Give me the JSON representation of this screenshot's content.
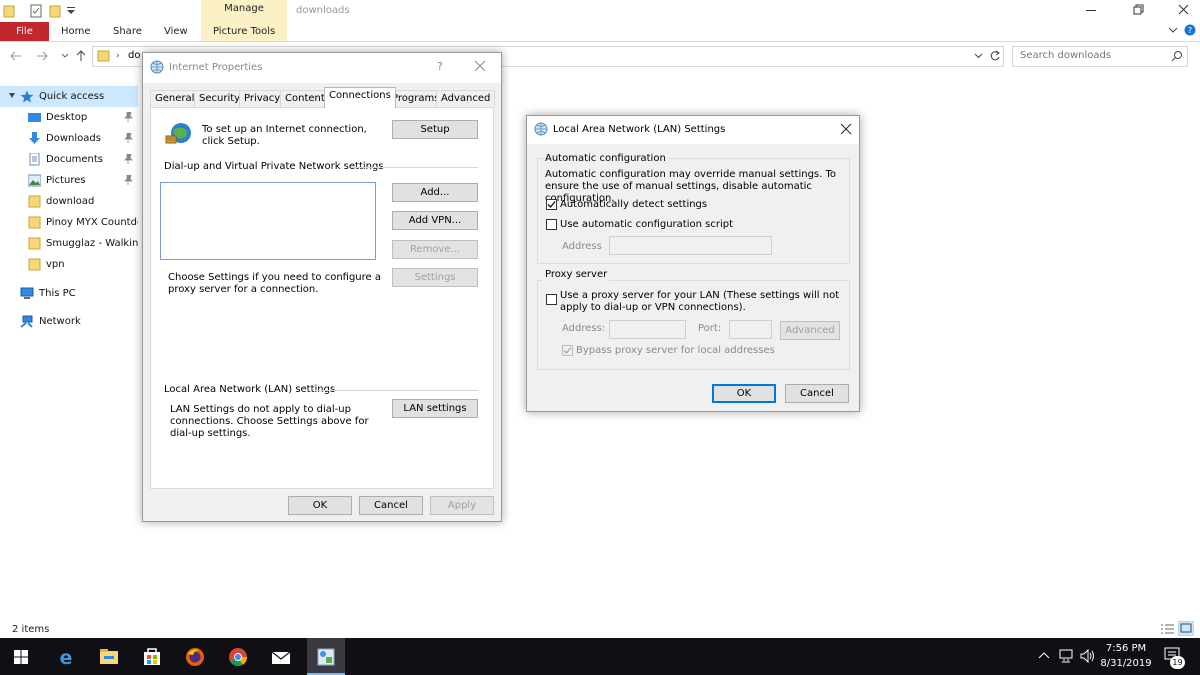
{
  "explorer": {
    "window_title": "downloads",
    "contextual_tab": "Manage",
    "tabs": [
      "File",
      "Home",
      "Share",
      "View",
      "Picture Tools"
    ],
    "address_path": "do",
    "search_placeholder": "Search downloads",
    "nav": {
      "quick_access": "Quick access",
      "items": [
        {
          "label": "Desktop",
          "icon": "desktop-icon",
          "pinned": true
        },
        {
          "label": "Downloads",
          "icon": "download-arrow-icon",
          "pinned": true
        },
        {
          "label": "Documents",
          "icon": "documents-icon",
          "pinned": true
        },
        {
          "label": "Pictures",
          "icon": "pictures-icon",
          "pinned": true
        },
        {
          "label": "download",
          "icon": "folder-icon",
          "pinned": false
        },
        {
          "label": "Pinoy MYX Countdown",
          "icon": "folder-icon",
          "pinned": false
        },
        {
          "label": "Smugglaz - Walking",
          "icon": "folder-icon",
          "pinned": false
        },
        {
          "label": "vpn",
          "icon": "folder-icon",
          "pinned": false
        }
      ],
      "this_pc": "This PC",
      "network": "Network"
    },
    "status": "2 items"
  },
  "internet_properties": {
    "title": "Internet Properties",
    "help": "?",
    "tabs": [
      "General",
      "Security",
      "Privacy",
      "Content",
      "Connections",
      "Programs",
      "Advanced"
    ],
    "selected_tab": "Connections",
    "setup_text": "To set up an Internet connection, click Setup.",
    "setup_btn": "Setup",
    "dialup_heading": "Dial-up and Virtual Private Network settings",
    "add_btn": "Add...",
    "add_vpn_btn": "Add VPN...",
    "remove_btn": "Remove...",
    "settings_btn": "Settings",
    "proxy_text": "Choose Settings if you need to configure a proxy server for a connection.",
    "lan_heading": "Local Area Network (LAN) settings",
    "lan_text": "LAN Settings do not apply to dial-up connections. Choose Settings above for dial-up settings.",
    "lan_btn": "LAN settings",
    "ok": "OK",
    "cancel": "Cancel",
    "apply": "Apply"
  },
  "lan_settings": {
    "title": "Local Area Network (LAN) Settings",
    "auto_heading": "Automatic configuration",
    "auto_text": "Automatic configuration may override manual settings.  To ensure the use of manual settings, disable automatic configuration.",
    "auto_detect": {
      "label": "Automatically detect settings",
      "checked": true
    },
    "auto_script": {
      "label": "Use automatic configuration script",
      "checked": false
    },
    "address_label": "Address",
    "proxy_heading": "Proxy server",
    "use_proxy": {
      "label": "Use a proxy server for your LAN (These settings will not apply to dial-up or VPN connections).",
      "checked": false
    },
    "proxy_address_label": "Address:",
    "port_label": "Port:",
    "advanced_btn": "Advanced",
    "bypass": {
      "label": "Bypass proxy server for local addresses",
      "checked": true
    },
    "ok": "OK",
    "cancel": "Cancel"
  },
  "taskbar": {
    "apps": [
      "windows-start-icon",
      "edge-icon",
      "file-explorer-icon",
      "store-icon",
      "firefox-icon",
      "chrome-icon",
      "mail-icon",
      "control-panel-icon"
    ],
    "time": "7:56 PM",
    "date": "8/31/2019",
    "notification_count": "19"
  },
  "colors": {
    "file_tab": "#c1272d",
    "manage_band": "#fbf0c6",
    "selection": "#cce8ff",
    "accent": "#0078d7",
    "taskbar": "#101014"
  }
}
